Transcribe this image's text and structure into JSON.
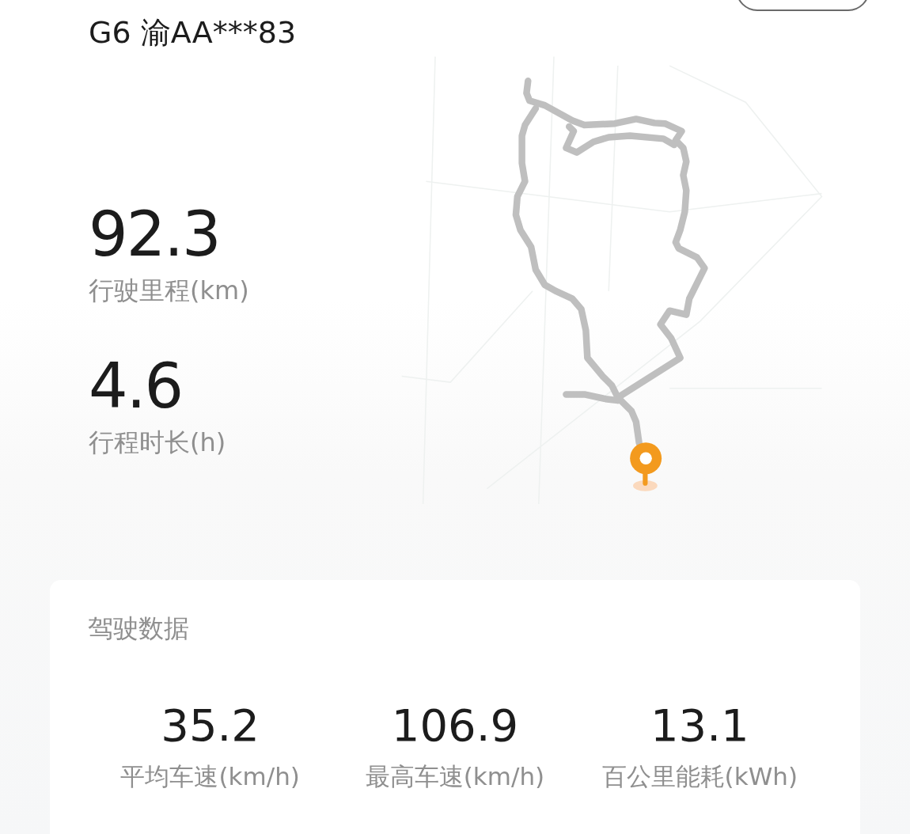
{
  "header": {
    "title": "G6 渝AA***83"
  },
  "summary": [
    {
      "value": "92.3",
      "label": "行驶里程(km)"
    },
    {
      "value": "4.6",
      "label": "行程时长(h)"
    }
  ],
  "driving_data": {
    "title": "驾驶数据",
    "stats": [
      {
        "value": "35.2",
        "label": "平均车速(km/h)"
      },
      {
        "value": "106.9",
        "label": "最高车速(km/h)"
      },
      {
        "value": "13.1",
        "label": "百公里能耗(kWh)"
      }
    ]
  }
}
